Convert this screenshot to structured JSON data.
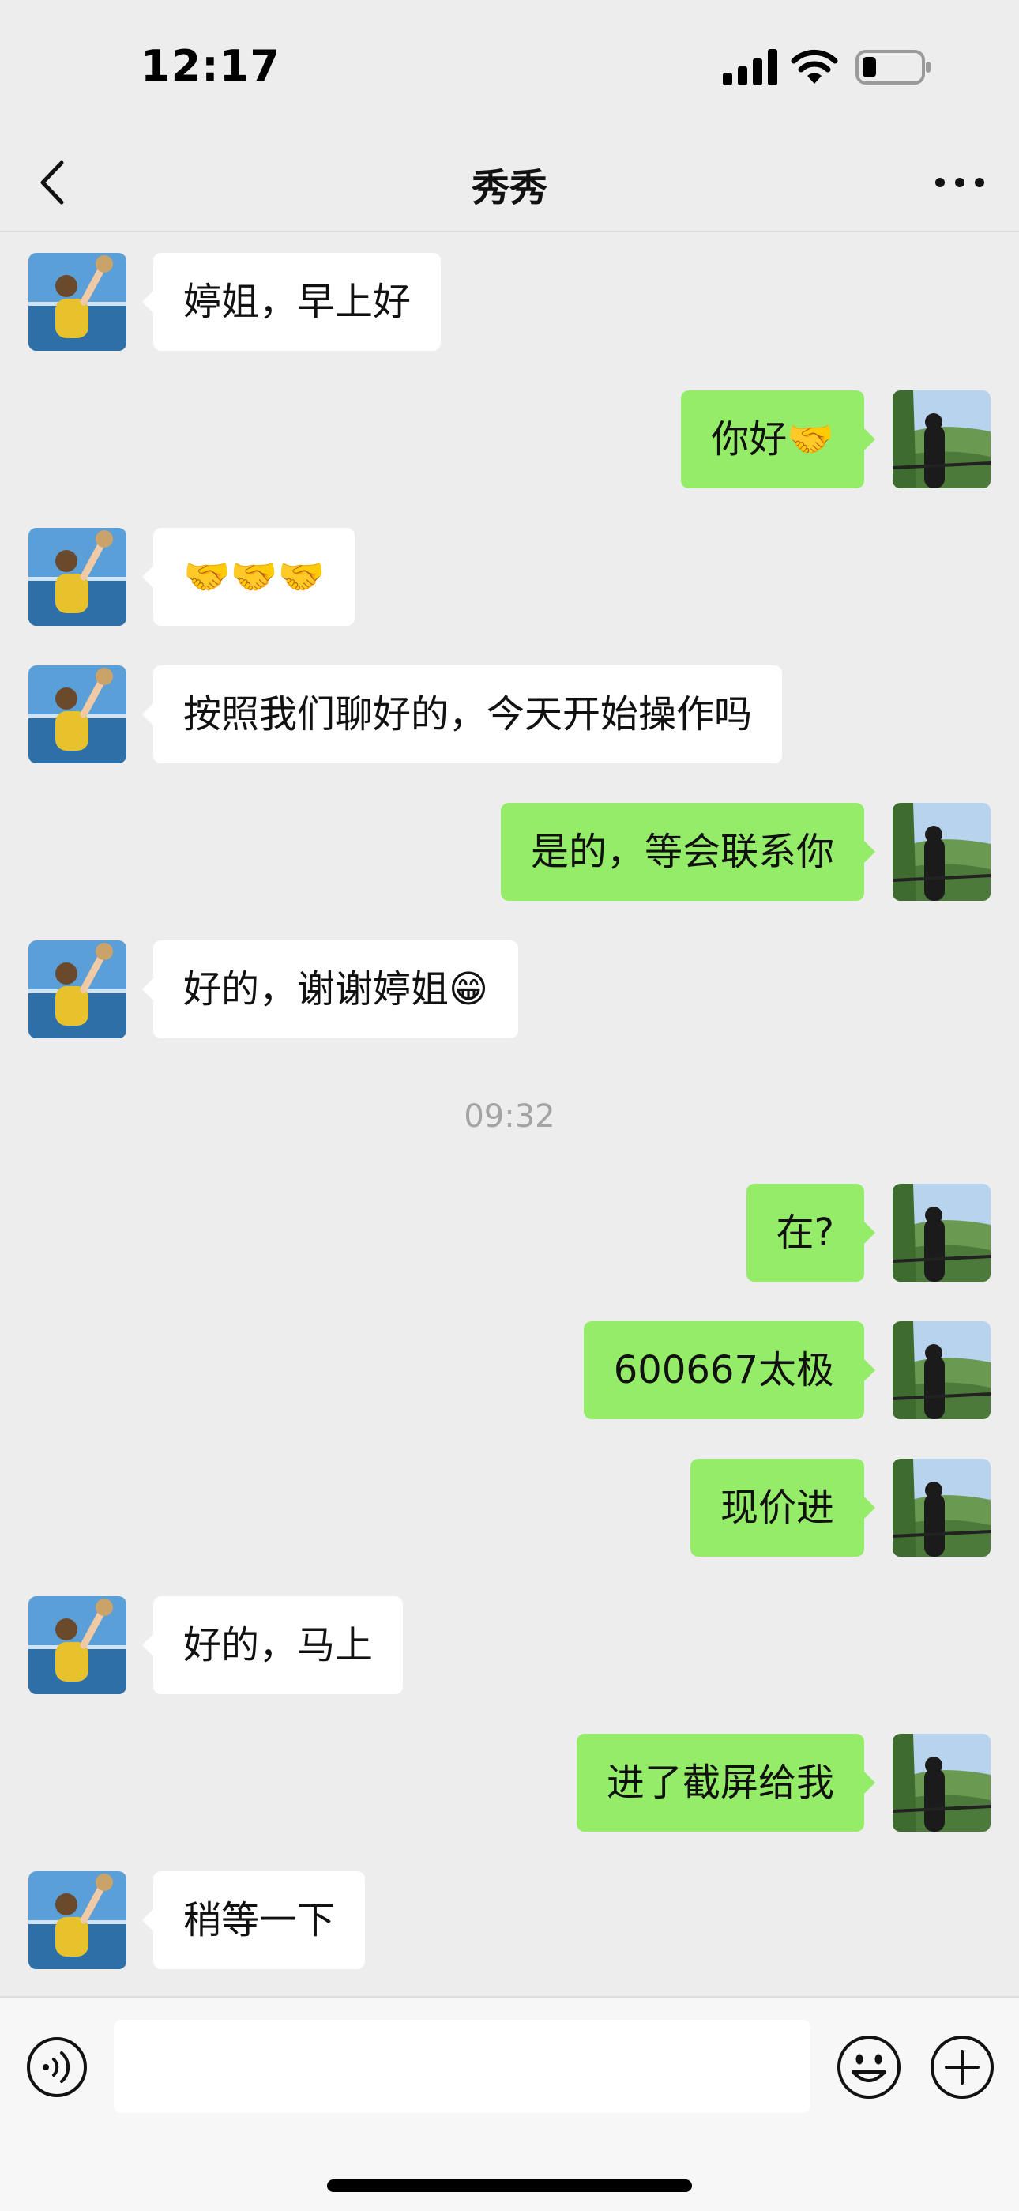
{
  "status_bar": {
    "time": "12:17"
  },
  "header": {
    "title": "秀秀"
  },
  "icons": {
    "back": "chevron-left-icon",
    "more": "more-dots-icon",
    "voice": "voice-icon",
    "emoji": "emoji-icon",
    "plus": "plus-icon",
    "signal": "cellular-signal-icon",
    "wifi": "wifi-icon",
    "battery": "battery-icon"
  },
  "colors": {
    "incoming_bubble": "#ffffff",
    "outgoing_bubble": "#95ec69",
    "background": "#ededed"
  },
  "messages": [
    {
      "side": "left",
      "text": "婷姐，早上好"
    },
    {
      "side": "right",
      "text": "你好🤝"
    },
    {
      "side": "left",
      "text": "🤝🤝🤝"
    },
    {
      "side": "left",
      "text": "按照我们聊好的，今天开始操作吗"
    },
    {
      "side": "right",
      "text": "是的，等会联系你"
    },
    {
      "side": "left",
      "text": "好的，谢谢婷姐😁"
    },
    {
      "side": "time",
      "text": "09:32"
    },
    {
      "side": "right",
      "text": "在?"
    },
    {
      "side": "right",
      "text": "600667太极"
    },
    {
      "side": "right",
      "text": "现价进"
    },
    {
      "side": "left",
      "text": "好的，马上"
    },
    {
      "side": "right",
      "text": "进了截屏给我"
    },
    {
      "side": "left",
      "text": "稍等一下"
    }
  ],
  "input": {
    "value": ""
  }
}
